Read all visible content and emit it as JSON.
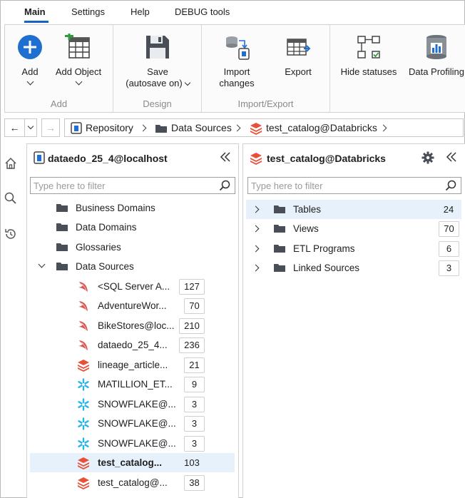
{
  "menu": {
    "tabs": [
      {
        "label": "Main",
        "active": true
      },
      {
        "label": "Settings"
      },
      {
        "label": "Help"
      },
      {
        "label": "DEBUG tools"
      }
    ]
  },
  "ribbon": {
    "groups": {
      "add": {
        "label": "Add",
        "buttons": [
          {
            "label": "Add",
            "icon": "plus-circle-icon"
          },
          {
            "label": "Add Object",
            "icon": "add-grid-icon"
          }
        ]
      },
      "design": {
        "label": "Design",
        "buttons": [
          {
            "label": "Save",
            "label2": "(autosave on)",
            "icon": "save-disk-icon"
          }
        ]
      },
      "import_export": {
        "label": "Import/Export",
        "buttons": [
          {
            "label": "Import",
            "label2": "changes",
            "icon": "import-db-icon"
          },
          {
            "label": "Export",
            "icon": "export-grid-icon"
          }
        ]
      },
      "other": {
        "buttons": [
          {
            "label": "Hide statuses",
            "icon": "statuses-diagram-icon"
          },
          {
            "label": "Data Profiling",
            "icon": "profiling-db-icon"
          }
        ]
      }
    }
  },
  "nav": {
    "back": "←",
    "forward": "→",
    "breadcrumb": [
      "Repository",
      "Data Sources",
      "test_catalog@Databricks"
    ]
  },
  "left_panel": {
    "title": "dataedo_25_4@localhost",
    "filter_placeholder": "Type here to filter",
    "folders": [
      {
        "label": "Business Domains"
      },
      {
        "label": "Data Domains"
      },
      {
        "label": "Glossaries"
      },
      {
        "label": "Data Sources",
        "expanded": true
      }
    ],
    "sources": [
      {
        "label": "<SQL Server A...",
        "count": "127",
        "icon": "sqlserver-icon"
      },
      {
        "label": "AdventureWor...",
        "count": "70",
        "icon": "sqlserver-icon"
      },
      {
        "label": "BikeStores@loc...",
        "count": "210",
        "icon": "sqlserver-icon"
      },
      {
        "label": "dataedo_25_4...",
        "count": "236",
        "icon": "sqlserver-icon"
      },
      {
        "label": "lineage_article...",
        "count": "21",
        "icon": "databricks-icon"
      },
      {
        "label": "MATILLION_ET...",
        "count": "9",
        "icon": "snowflake-icon"
      },
      {
        "label": "SNOWFLAKE@...",
        "count": "3",
        "icon": "snowflake-icon"
      },
      {
        "label": "SNOWFLAKE@...",
        "count": "3",
        "icon": "snowflake-icon"
      },
      {
        "label": "SNOWFLAKE@...",
        "count": "3",
        "icon": "snowflake-icon"
      },
      {
        "label": "test_catalog...",
        "count": "103",
        "icon": "databricks-icon",
        "selected": true
      },
      {
        "label": "test_catalog@...",
        "count": "38",
        "icon": "databricks-icon"
      }
    ]
  },
  "right_panel": {
    "title": "test_catalog@Databricks",
    "filter_placeholder": "Type here to filter",
    "items": [
      {
        "label": "Tables",
        "count": "24",
        "selected": true
      },
      {
        "label": "Views",
        "count": "70"
      },
      {
        "label": "ETL Programs",
        "count": "6"
      },
      {
        "label": "Linked Sources",
        "count": "3"
      }
    ]
  },
  "colors": {
    "accent": "#1565c0",
    "selection": "#e7f1fb",
    "databricks": "#e8503a",
    "snowflake": "#29b5e8",
    "sqlserver": "#d9534f"
  }
}
